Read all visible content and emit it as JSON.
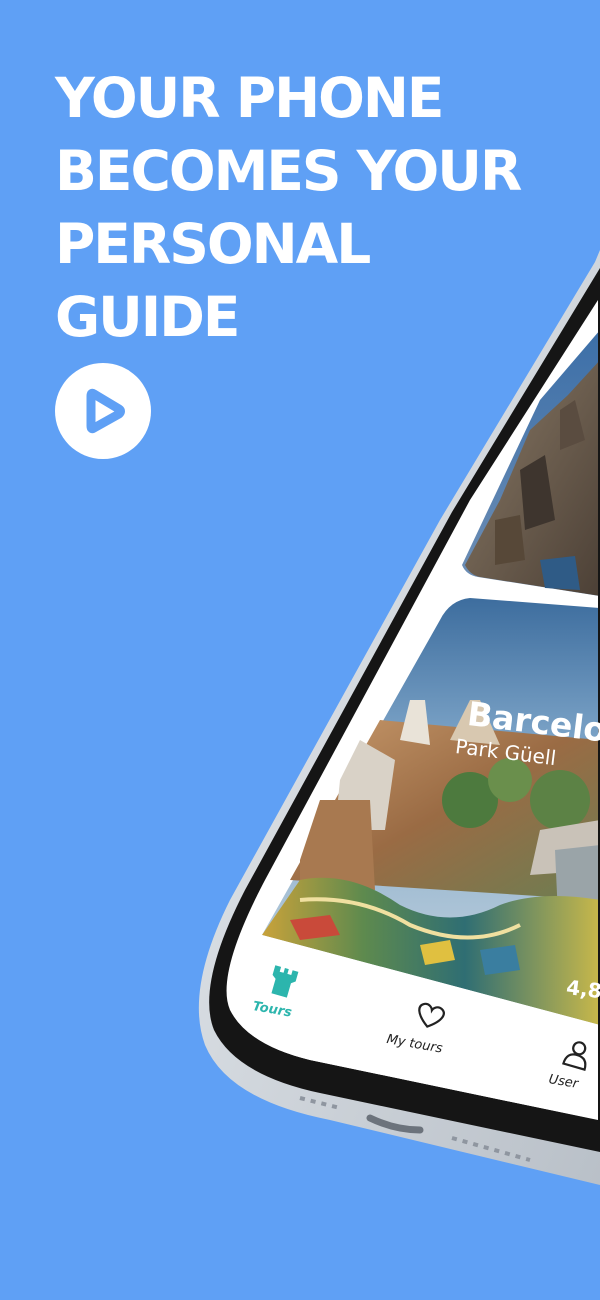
{
  "headline": {
    "lines": [
      "YOUR PHONE",
      "BECOMES YOUR",
      "PERSONAL",
      "GUIDE"
    ]
  },
  "play_button": {
    "icon": "play-icon"
  },
  "card": {
    "city": "Barcelo",
    "place": "Park Güell",
    "rating": "4,8"
  },
  "tabbar": {
    "tours": "Tours",
    "my_tours": "My tours",
    "user": "User"
  },
  "colors": {
    "background": "#5fa0f5",
    "accent": "#2cb5ad",
    "text_dark": "#222222"
  }
}
